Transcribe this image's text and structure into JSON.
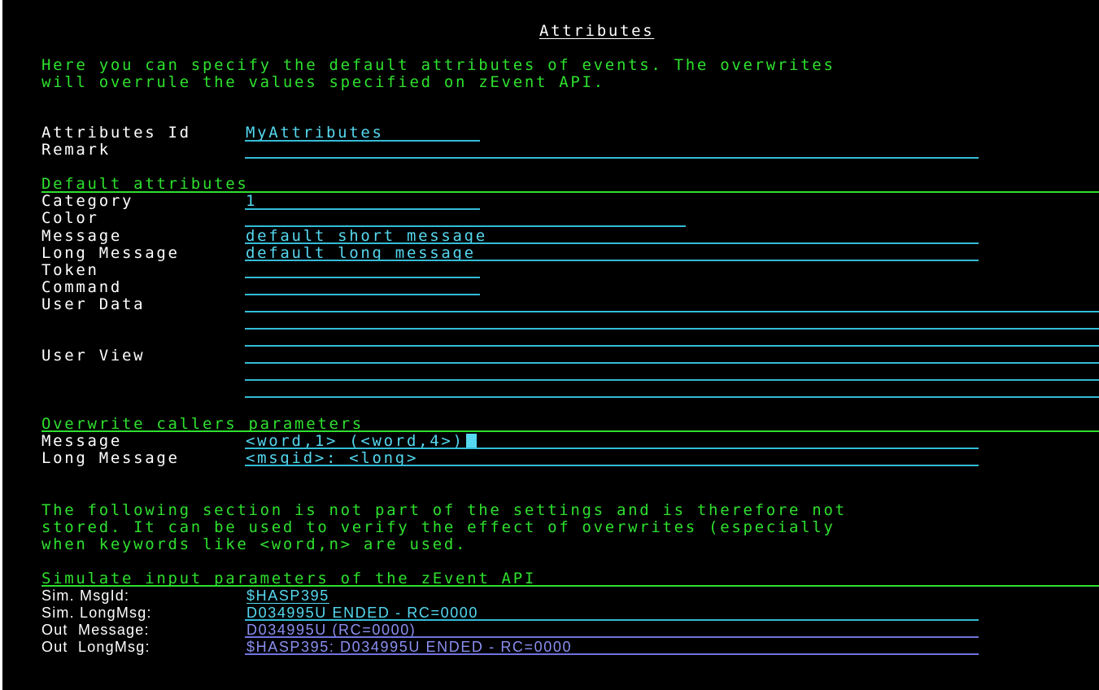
{
  "title": "Attributes",
  "intro": [
    "Here you can specify the default attributes of events. The overwrites",
    "will overrule the values specified on zEvent API."
  ],
  "attributes_id": {
    "label": "Attributes Id",
    "value": "MyAttributes"
  },
  "remark": {
    "label": "Remark",
    "value": ""
  },
  "default_section": {
    "heading": "Default attributes",
    "category": {
      "label": "Category",
      "value": "1"
    },
    "color": {
      "label": "Color",
      "value": ""
    },
    "message": {
      "label": "Message",
      "value": "default short message"
    },
    "long_message": {
      "label": "Long Message",
      "value": "default long message"
    },
    "token": {
      "label": "Token",
      "value": ""
    },
    "command": {
      "label": "Command",
      "value": ""
    },
    "user_data": {
      "label": "User Data"
    },
    "user_view": {
      "label": "User View"
    }
  },
  "overwrite_section": {
    "heading": "Overwrite callers parameters",
    "message": {
      "label": "Message",
      "value": "<word,1> (<word,4>)"
    },
    "long_message": {
      "label": "Long Message",
      "value": "<msgid>: <long>"
    }
  },
  "note": [
    "The following section is not part of the settings and is therefore not",
    "stored. It can be used to verify the effect of overwrites (especially",
    "when keywords like <word,n> are used."
  ],
  "simulate_section": {
    "heading": "Simulate input parameters of the zEvent API",
    "sim_msgid": {
      "label": "Sim. MsgId:",
      "value": "$HASP395"
    },
    "sim_longmsg": {
      "label": "Sim. LongMsg:",
      "value": "D034995U ENDED - RC=0000"
    },
    "out_message": {
      "label": "Out  Message:",
      "value": "D034995U (RC=0000)"
    },
    "out_longmsg": {
      "label": "Out  LongMsg:",
      "value": "$HASP395: D034995U ENDED - RC=0000"
    }
  },
  "colors": {
    "background": "#000000",
    "text_green": "#2ee02e",
    "text_white": "#ffffff",
    "field_turquoise": "#55d8f0",
    "output_blue": "#8a8ff0"
  }
}
